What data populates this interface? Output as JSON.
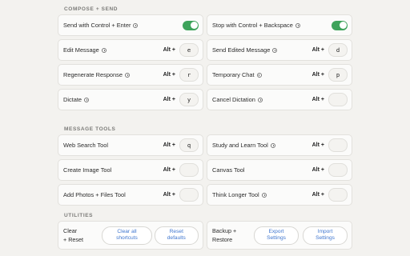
{
  "sections": {
    "compose": "COMPOSE + SEND",
    "tools": "MESSAGE TOOLS",
    "utilities": "UTILITIES"
  },
  "modifier": "Alt +",
  "compose": {
    "send_label": "Send with Control + Enter",
    "stop_label": "Stop with Control + Backspace",
    "send_toggle_on": true,
    "stop_toggle_on": true,
    "rows": [
      {
        "left": {
          "label": "Edit Message",
          "key": "e"
        },
        "right": {
          "label": "Send Edited Message",
          "key": "d"
        }
      },
      {
        "left": {
          "label": "Regenerate Response",
          "key": "r"
        },
        "right": {
          "label": "Temporary Chat",
          "key": "p"
        }
      },
      {
        "left": {
          "label": "Dictate",
          "key": "y"
        },
        "right": {
          "label": "Cancel Dictation",
          "key": ""
        }
      }
    ]
  },
  "tools": {
    "rows": [
      {
        "left": {
          "label": "Web Search Tool",
          "key": "q"
        },
        "right": {
          "label": "Study and Learn Tool",
          "key": ""
        }
      },
      {
        "left": {
          "label": "Create Image Tool",
          "key": ""
        },
        "right": {
          "label": "Canvas Tool",
          "key": ""
        }
      },
      {
        "left": {
          "label": "Add Photos + Files Tool",
          "key": ""
        },
        "right": {
          "label": "Think Longer Tool",
          "key": ""
        }
      }
    ]
  },
  "utilities": {
    "clear_label_1": "Clear",
    "clear_label_2": "+ Reset",
    "clear_all_1": "Clear all",
    "clear_all_2": "shortcuts",
    "reset_1": "Reset",
    "reset_2": "defaults",
    "backup_label_1": "Backup +",
    "backup_label_2": "Restore",
    "export_1": "Export",
    "export_2": "Settings",
    "import_1": "Import",
    "import_2": "Settings"
  },
  "colors": {
    "toggle_on": "#3ea35b",
    "link": "#3f76cf",
    "background": "#f3f2ef"
  }
}
